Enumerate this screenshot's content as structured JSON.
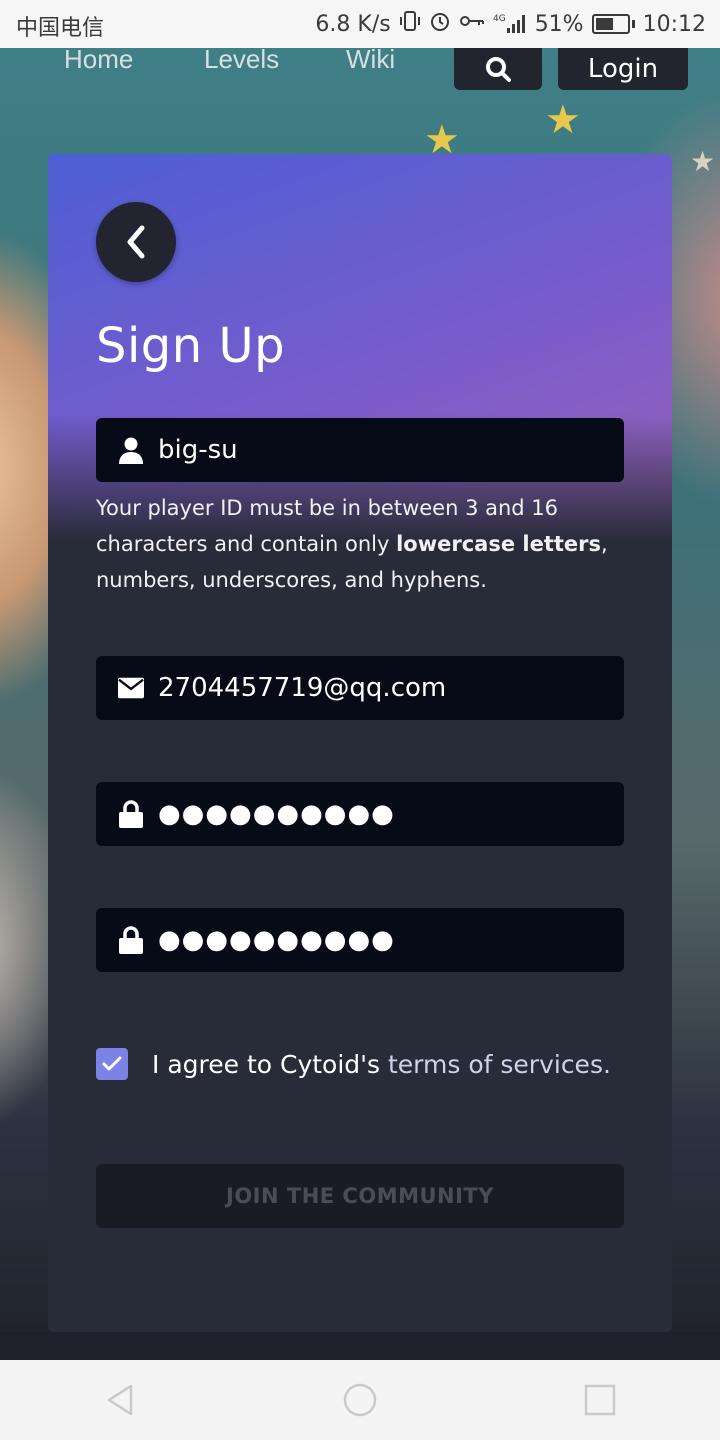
{
  "status_bar": {
    "carrier": "中国电信",
    "speed": "6.8 K/s",
    "network": "4G",
    "battery": "51%",
    "time": "10:12"
  },
  "nav": {
    "links": [
      "Home",
      "Levels",
      "Wiki"
    ],
    "login_label": "Login"
  },
  "form": {
    "title": "Sign Up",
    "username": "big-su",
    "helper_part1": "Your player ID must be in between 3 and 16 characters and contain only ",
    "helper_bold": "lowercase letters",
    "helper_part2": ", numbers, underscores, and hyphens.",
    "email": "2704457719@qq.com",
    "password_mask": "●●●●●●●●●●",
    "confirm_mask": "●●●●●●●●●●",
    "agree_prefix": "I agree to Cytoid's ",
    "agree_link": "terms of services.",
    "agree_checked": true,
    "submit_label": "JOIN THE COMMUNITY"
  },
  "colors": {
    "accent": "#7b84e6",
    "field_bg": "#070a17",
    "card_bg": "#282b38"
  }
}
